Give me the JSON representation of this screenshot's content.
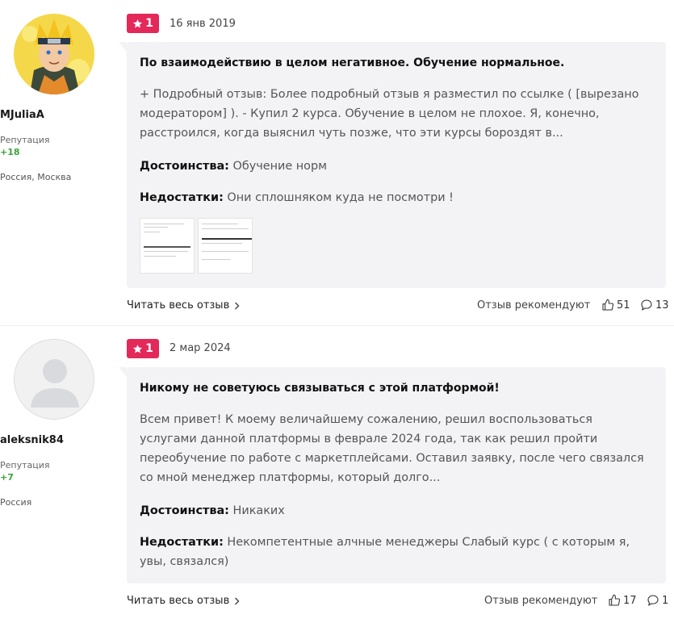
{
  "colors": {
    "badge": "#e3285a",
    "reputation": "#3aa53a",
    "bubble": "#f3f3f5"
  },
  "reviews": [
    {
      "author": {
        "name": "MJuliaA",
        "reputation_label": "Репутация",
        "reputation_value": "+18",
        "location": "Россия, Москва",
        "avatar": "anime-character-avatar"
      },
      "rating": "1",
      "date": "16 янв 2019",
      "title": "По взаимодействию в целом негативное. Обучение нормальное.",
      "body": "+ Подробный отзыв: Более подробный отзыв я разместил по ссылке ( [вырезано модератором] ). - Купил 2 курса. Обучение в целом не плохое. Я, конечно, расстроился, когда выяснил чуть позже, что эти курсы бороздят в...",
      "pros_label": "Достоинства:",
      "pros": "Обучение норм",
      "cons_label": "Недостатки:",
      "cons": "Они сплошняком куда не посмотри !",
      "read_more": "Читать весь отзыв",
      "recommend_label": "Отзыв рекомендуют",
      "likes": "51",
      "comments": "13"
    },
    {
      "author": {
        "name": "aleksnik84",
        "reputation_label": "Репутация",
        "reputation_value": "+7",
        "location": "Россия",
        "avatar": "default-user-avatar"
      },
      "rating": "1",
      "date": "2 мар 2024",
      "title": "Никому не советуюсь связываться с этой платформой!",
      "body": "Всем привет! К моему величайшему сожалению, решил воспользоваться услугами данной платформы в феврале 2024 года, так как решил пройти переобучение по работе с маркетплейсами. Оставил заявку, после чего связался со мной менеджер платформы, который долго...",
      "pros_label": "Достоинства:",
      "pros": "Никаких",
      "cons_label": "Недостатки:",
      "cons": "Некомпетентные алчные менеджеры Слабый курс ( с которым я, увы, связался)",
      "read_more": "Читать весь отзыв",
      "recommend_label": "Отзыв рекомендуют",
      "likes": "17",
      "comments": "1"
    }
  ]
}
